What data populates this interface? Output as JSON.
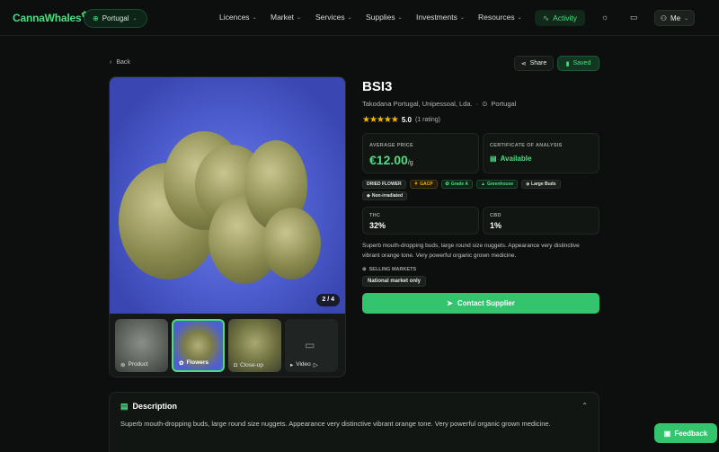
{
  "nav": {
    "logo": "CannaWhales",
    "country": "Portugal",
    "items": [
      "Licences",
      "Market",
      "Services",
      "Supplies",
      "Investments",
      "Resources"
    ],
    "activity": "Activity",
    "me": "Me"
  },
  "page": {
    "back": "Back",
    "share": "Share",
    "saved": "Saved"
  },
  "gallery": {
    "counter": "2 / 4",
    "thumbs": [
      "Product",
      "Flowers",
      "Close-up",
      "Video"
    ]
  },
  "product": {
    "title": "BSI3",
    "supplier": "Takodana Portugal, Unipessoal, Lda.",
    "location": "Portugal",
    "rating_score": "5.0",
    "rating_count": "(1 rating)",
    "avg_price_label": "AVERAGE PRICE",
    "avg_price": "€12.00",
    "unit": "/g",
    "coa_label": "CERTIFICATE OF ANALYSIS",
    "coa_value": "Available",
    "tags": [
      "DRIED FLOWER",
      "GACP",
      "Grade A",
      "Greenhouse",
      "Large Buds",
      "Non-irradiated"
    ],
    "thc_label": "THC",
    "thc": "32%",
    "cbd_label": "CBD",
    "cbd": "1%",
    "short_description": "Superb mouth-dropping buds, large round size nuggets. Appearance very distinctive vibrant orange tone. Very powerful organic grown medicine.",
    "markets_label": "SELLING MARKETS",
    "market": "National market only",
    "contact": "Contact Supplier"
  },
  "description": {
    "heading": "Description",
    "text": "Superb mouth-dropping buds, large round size nuggets. Appearance very distinctive vibrant orange tone. Very powerful organic grown medicine."
  },
  "feedback": "Feedback",
  "colors": {
    "accent": "#4ade80",
    "button": "#34c46e",
    "star": "#f5b700",
    "background": "#0c0f0d"
  }
}
